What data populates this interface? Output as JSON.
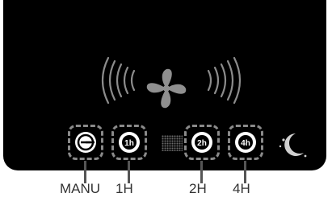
{
  "modes": [
    {
      "id": "manual",
      "label": "MANU",
      "icon": "manual-power-icon"
    },
    {
      "id": "timer-1h",
      "label": "1H",
      "icon": "timer-1h-icon",
      "badge": "1h"
    },
    {
      "id": "timer-2h",
      "label": "2H",
      "icon": "timer-2h-icon",
      "badge": "2h"
    },
    {
      "id": "timer-4h",
      "label": "4H",
      "icon": "timer-4h-icon",
      "badge": "4h"
    }
  ],
  "icons": {
    "fan": "fan-icon",
    "airflow": "airflow-waves-icon",
    "night": "night-moon-icon"
  },
  "colors": {
    "panel": "#000000",
    "icon": "#ffffff",
    "button_border": "#8a8a8a",
    "label_text": "#333333"
  }
}
